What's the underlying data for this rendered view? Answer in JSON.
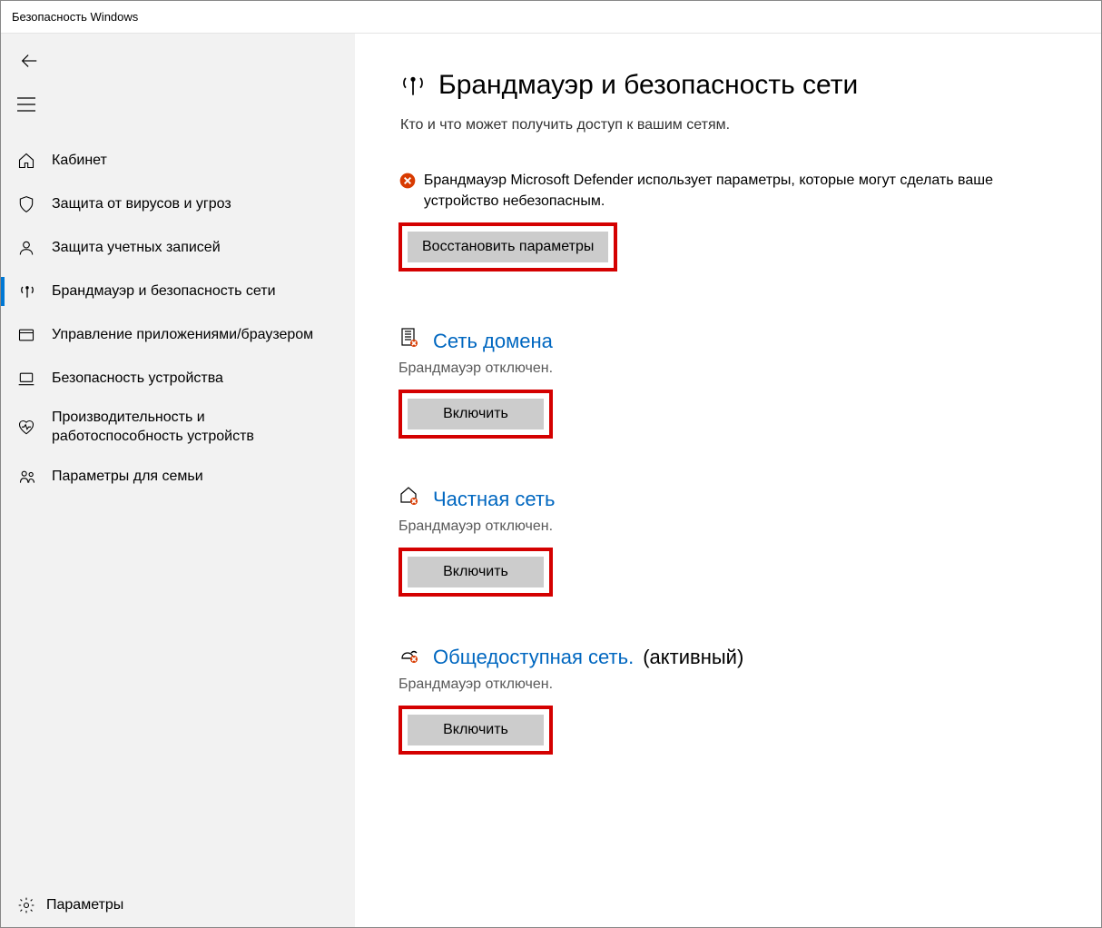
{
  "window": {
    "title": "Безопасность Windows"
  },
  "sidebar": {
    "items": [
      {
        "label": "Кабинет"
      },
      {
        "label": "Защита от вирусов и угроз"
      },
      {
        "label": "Защита учетных записей"
      },
      {
        "label": "Брандмауэр и безопасность сети"
      },
      {
        "label": "Управление приложениями/браузером"
      },
      {
        "label": "Безопасность устройства"
      },
      {
        "label": "Производительность и работоспособность устройств"
      },
      {
        "label": "Параметры для семьи"
      }
    ],
    "footer": {
      "label": "Параметры"
    }
  },
  "page": {
    "title": "Брандмауэр и безопасность сети",
    "subtitle": "Кто и что может получить доступ к вашим сетям."
  },
  "warning": {
    "text": "Брандмауэр Microsoft Defender использует параметры, которые могут сделать ваше устройство небезопасным.",
    "button_label": "Восстановить параметры"
  },
  "networks": [
    {
      "title": "Сеть домена",
      "status": "Брандмауэр отключен.",
      "button_label": "Включить",
      "active_suffix": ""
    },
    {
      "title": "Частная сеть",
      "status": "Брандмауэр отключен.",
      "button_label": "Включить",
      "active_suffix": ""
    },
    {
      "title": "Общедоступная сеть.",
      "status": "Брандмауэр отключен.",
      "button_label": "Включить",
      "active_suffix": "(активный)"
    }
  ]
}
